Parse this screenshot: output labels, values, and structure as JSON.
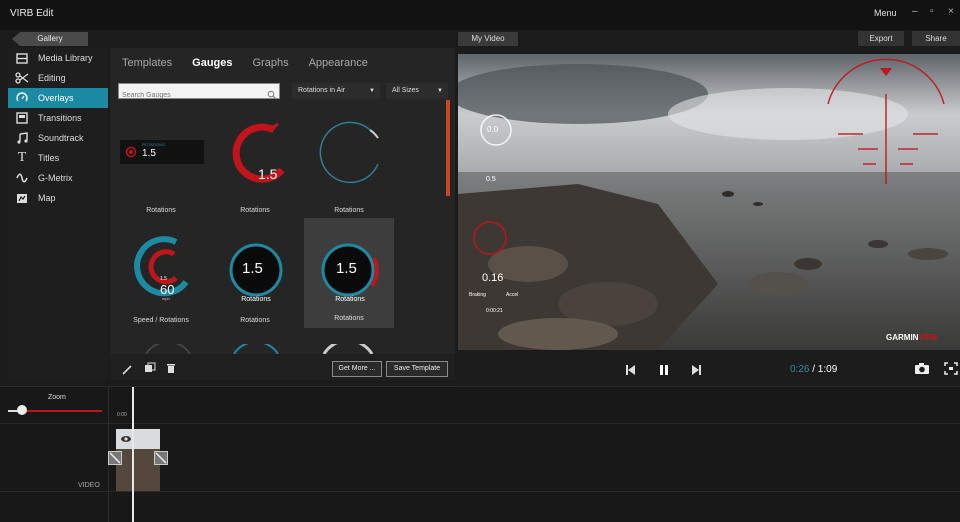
{
  "app": {
    "title": "VIRB Edit",
    "menu": "Menu",
    "win_min": "–",
    "win_max": "▫",
    "win_close": "×"
  },
  "topbar": {
    "gallery": "Gallery",
    "my_video": "My Video",
    "export": "Export",
    "share": "Share"
  },
  "sidebar": {
    "items": [
      {
        "label": "Media Library",
        "icon": "media-library-icon"
      },
      {
        "label": "Editing",
        "icon": "scissors-icon"
      },
      {
        "label": "Overlays",
        "icon": "gauge-icon",
        "active": true
      },
      {
        "label": "Transitions",
        "icon": "transitions-icon"
      },
      {
        "label": "Soundtrack",
        "icon": "music-note-icon"
      },
      {
        "label": "Titles",
        "icon": "text-t-icon"
      },
      {
        "label": "G-Metrix",
        "icon": "gmetrix-icon"
      },
      {
        "label": "Map",
        "icon": "map-icon"
      }
    ]
  },
  "panel": {
    "tabs": [
      "Templates",
      "Gauges",
      "Graphs",
      "Appearance"
    ],
    "active_tab": "Gauges",
    "search_placeholder": "Search Gauges",
    "filter_primary": "Rotations in Air",
    "filter_size": "All Sizes",
    "gauges": [
      {
        "label": "Rotations",
        "value": "1.5",
        "header": "ROTATIONS"
      },
      {
        "label": "Rotations",
        "value": "1.5"
      },
      {
        "label": "Rotations",
        "value": ""
      },
      {
        "label": "Speed / Rotations",
        "value": "60",
        "sub": "1.5",
        "unit": "mph"
      },
      {
        "label": "Rotations",
        "value": "1.5",
        "caption": "Rotations"
      },
      {
        "label": "Rotations",
        "value": "1.5",
        "caption": "Rotations",
        "selected": true
      }
    ],
    "get_more": "Get More ...",
    "save_template": "Save Template"
  },
  "preview": {
    "overlay_zero": "0.0",
    "overlay_speed": "0.16",
    "overlay_small": "0.5",
    "overlay_braking": "Braking",
    "overlay_accel": "Accel",
    "overlay_time": "0:00:21",
    "brand": "GARMIN",
    "brand_suffix": "VIRB",
    "accent": "#c0151a"
  },
  "playback": {
    "current": "0:26",
    "total": "/ 1:09",
    "accent": "#2e8b9c"
  },
  "timeline": {
    "zoom_label": "Zoom",
    "zoom_level": 0.15,
    "track_label": "VIDEO",
    "marker": "0:00"
  }
}
